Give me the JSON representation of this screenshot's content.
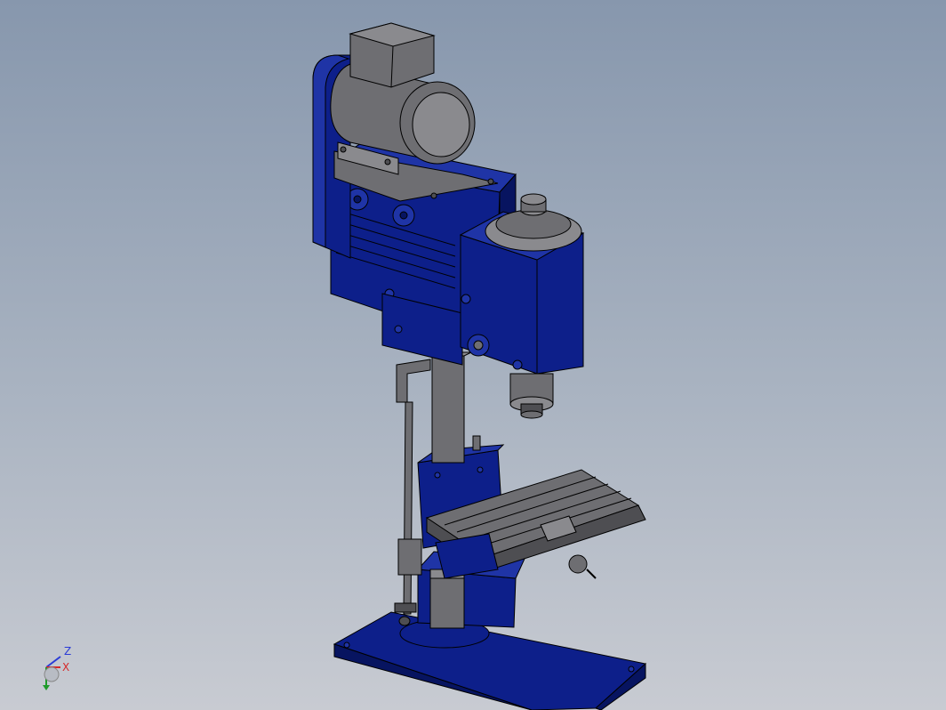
{
  "viewport": {
    "background_top": "#8797ad",
    "background_bottom": "#c8cbd2"
  },
  "model": {
    "body_color": "#0d1f8a",
    "body_shade": "#071460",
    "body_light": "#1f34a6",
    "metal_color": "#6e6e72",
    "metal_dark": "#4e4e52",
    "metal_light": "#8a8a8e"
  },
  "triad": {
    "z_label": "Z",
    "x_label": "X",
    "z_color": "#2a3bd6",
    "x_color": "#d62a2a",
    "y_color": "#1f9a2a"
  }
}
